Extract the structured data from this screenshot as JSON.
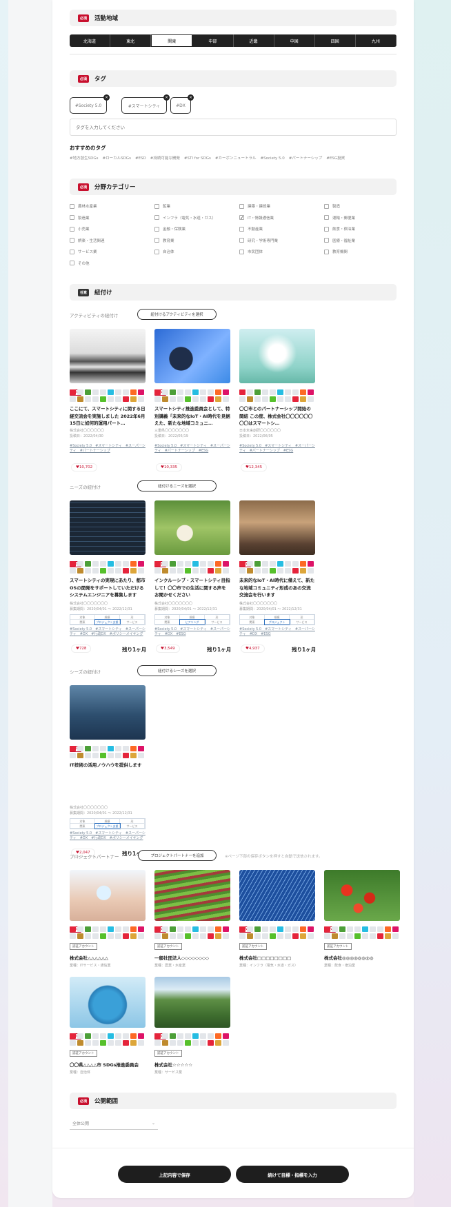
{
  "activity_region": {
    "badge": "必須",
    "title": "活動地域",
    "regions": [
      "北海道",
      "東北",
      "関東",
      "中部",
      "近畿",
      "中国",
      "四国",
      "九州"
    ],
    "active_index": 2
  },
  "tags": {
    "badge": "必須",
    "title": "タグ",
    "chips": [
      "#Society 5.0",
      "#スマートシティ",
      "#DX"
    ],
    "input_placeholder": "タグを入力してください",
    "recommended_title": "おすすめのタグ",
    "recommended": [
      "#地方創生SDGs",
      "#ローカルSDGs",
      "#ESD",
      "#持続可能な開発",
      "#STI for SDGs",
      "#カーボンニュートラル",
      "#Society 5.0",
      "#パートナーシップ",
      "#ESG投資"
    ]
  },
  "field_category": {
    "badge": "必須",
    "title": "分野カテゴリー",
    "items": [
      {
        "label": "農林水産業",
        "checked": false
      },
      {
        "label": "鉱業",
        "checked": false
      },
      {
        "label": "建築・建設業",
        "checked": false
      },
      {
        "label": "製造",
        "checked": false
      },
      {
        "label": "製造業",
        "checked": false
      },
      {
        "label": "インフラ（電気・水道・ガス）",
        "checked": false
      },
      {
        "label": "IT・情報通信業",
        "checked": true
      },
      {
        "label": "運輸・郵便業",
        "checked": false
      },
      {
        "label": "小売業",
        "checked": false
      },
      {
        "label": "金融・保険業",
        "checked": false
      },
      {
        "label": "不動産業",
        "checked": false
      },
      {
        "label": "飲食・宿泊業",
        "checked": false
      },
      {
        "label": "娯楽・生活関連",
        "checked": false
      },
      {
        "label": "教育業",
        "checked": false
      },
      {
        "label": "研究・学術専門業",
        "checked": false
      },
      {
        "label": "医療・福祉業",
        "checked": false
      },
      {
        "label": "サービス業",
        "checked": false
      },
      {
        "label": "自治体",
        "checked": false
      },
      {
        "label": "市民団体",
        "checked": false
      },
      {
        "label": "教育機関",
        "checked": false
      },
      {
        "label": "その他",
        "checked": false
      }
    ]
  },
  "linking": {
    "badge": "任意",
    "title": "紐付け",
    "activity_label": "アクティビティの紐付け",
    "activity_button": "紐付けるアクティビティを選択",
    "needs_label": "ニーズの紐付け",
    "needs_button": "紐付けるニーズを選択",
    "seeds_label": "シーズの紐付け",
    "seeds_button": "紐付けるシーズを選択",
    "partner_label": "プロジェクトパートナー",
    "partner_button": "プロジェクトパートナーを追加",
    "partner_note": "※ページ下部の保存ボタンを押すと自動で送信されます。",
    "activities": [
      {
        "new": "NEW",
        "title": "ここにて、スマートシティに関する日経交流会を実施しました 2022年6月15日に如何的運用パート…",
        "company": "株式会社〇〇〇〇〇〇",
        "date": "投稿日：2022/04/30",
        "tags": "#Society 5.0　#スマートシティ　#スーパーシティ　#パートナーシップ",
        "likes": "10,702"
      },
      {
        "new": "NEW",
        "title": "スマートシティ推進委員会として、特別講義「未来的なIoT・AI時代を見据えた、新たな地域コミュニ…",
        "company": "三重県〇〇〇〇〇〇〇",
        "date": "投稿日：2022/05/19",
        "tags": "#Society 5.0　#スマートシティ　#スーパーシティ　#パートナーシップ　#ESG",
        "likes": "10,335"
      },
      {
        "new": "",
        "title": "〇〇市とのパートナーシップ開始の関結 この度、株式会社〇〇〇〇〇〇〇〇はスマートシ…",
        "company": "日本未来創研〇〇〇〇〇〇",
        "date": "投稿日：2022/06/05",
        "tags": "#Society 5.0　#スマートシティ　#スーパーシティ　#パートナーシップ　#ESG",
        "likes": "12,345"
      }
    ],
    "needs": [
      {
        "new": "NEW",
        "title": "スマートシティの実現にあたり、都市OSの開発をサポートしていただけるシステムエンジニアを募集します",
        "company": "株式会社〇〇〇〇〇〇〇",
        "period": "募集期間：2020/04/01 ～ 2022/12/31",
        "tags": "#Society 5.0　#スマートシティ　#スーパーシティ　#DX　#行政DX　#ポリシーメイキング",
        "likes": "728",
        "remain": "残り1ヶ月",
        "table": [
          "対象",
          "規模",
          "形",
          "関東",
          "プロジェクト支援",
          "サービス"
        ]
      },
      {
        "new": "NEW",
        "title": "インクルーシブ・スマートシティ目指して！〇〇市での生活に関する声をお聞かせください",
        "company": "株式会社〇〇〇〇〇〇〇",
        "period": "募集期間：2020/04/01 ～ 2022/12/31",
        "tags": "#Society 5.0　#スマートシティ　#スーパーシティ　#DX　#ESG",
        "likes": "3,549",
        "remain": "残り1ヶ月",
        "table": [
          "対象",
          "規模",
          "形",
          "関東",
          "ヒアリング",
          "サービス"
        ]
      },
      {
        "new": "NEW",
        "title": "未来的なIoT・AI時代に備えて、新たな地域コミュニティ形成のあの交流交流会を行います",
        "company": "株式会社〇〇〇〇〇〇〇",
        "period": "募集期間：2020/04/01 ～ 2022/12/31",
        "tags": "#Society 5.0　#スマートシティ　#スーパーシティ　#DX　#ESG",
        "likes": "4,937",
        "remain": "残り1ヶ月",
        "table": [
          "対象",
          "規模",
          "形",
          "関東",
          "プロジェクト",
          "サービス"
        ]
      }
    ],
    "seeds": [
      {
        "new": "NEW",
        "title": "IT技術の活用ノウハウを提供します",
        "company": "株式会社〇〇〇〇〇〇〇",
        "period": "募集期間：2020/04/01 ～ 2022/12/31",
        "tags": "#Society 5.0　#スマートシティ　#スーパーシティ　#DX　#行政DX　#ポリシーメイキング",
        "likes": "2,047",
        "remain": "残り1ヶ月",
        "table": [
          "対象",
          "規模",
          "形",
          "関東",
          "プロジェクト支援",
          "サービス"
        ]
      }
    ],
    "partners": [
      {
        "new": "NEW",
        "account": "認証アカウント",
        "name": "株式会社△△△△△△",
        "category": "業種：ITサービス・通信業"
      },
      {
        "new": "NEW",
        "account": "認証アカウント",
        "name": "一般社団法人◇◇◇◇◇◇◇◇",
        "category": "業種：農業・水産業"
      },
      {
        "new": "NEW",
        "account": "認証アカウント",
        "name": "株式会社□□□□□□□□",
        "category": "業種：インフラ（電気・水道・ガス）"
      },
      {
        "new": "NEW",
        "account": "認証アカウント",
        "name": "株式会社◎◎◎◎◎◎◎◎",
        "category": "業種：飲食・宿泊業"
      },
      {
        "new": "NEW",
        "account": "認証アカウント",
        "name": "〇〇県△△△△市 SDGs推進委員会",
        "category": "業種：自治体"
      },
      {
        "new": "NEW",
        "account": "認証アカウント",
        "name": "株式会社☆☆☆☆☆",
        "category": "業種：サービス業"
      }
    ]
  },
  "publish_scope": {
    "badge": "必須",
    "title": "公開範囲",
    "selected": "全体公開"
  },
  "buttons": {
    "save": "上記内容で保存",
    "next": "続けて目標・指標を入力"
  },
  "colors": {
    "accent_red": "#c8102e",
    "dark": "#1e1e1e",
    "sdg_palette": [
      "#e5243b",
      "#dda63a",
      "#4c9f38",
      "#c5192d",
      "#ff3a21",
      "#26bde2",
      "#fcc30b",
      "#a21942",
      "#fd6925",
      "#dd1367",
      "#fd9d24",
      "#bf8b2e",
      "#3f7e44",
      "#0a97d9",
      "#56c02b",
      "#00689d",
      "#19486a"
    ]
  }
}
